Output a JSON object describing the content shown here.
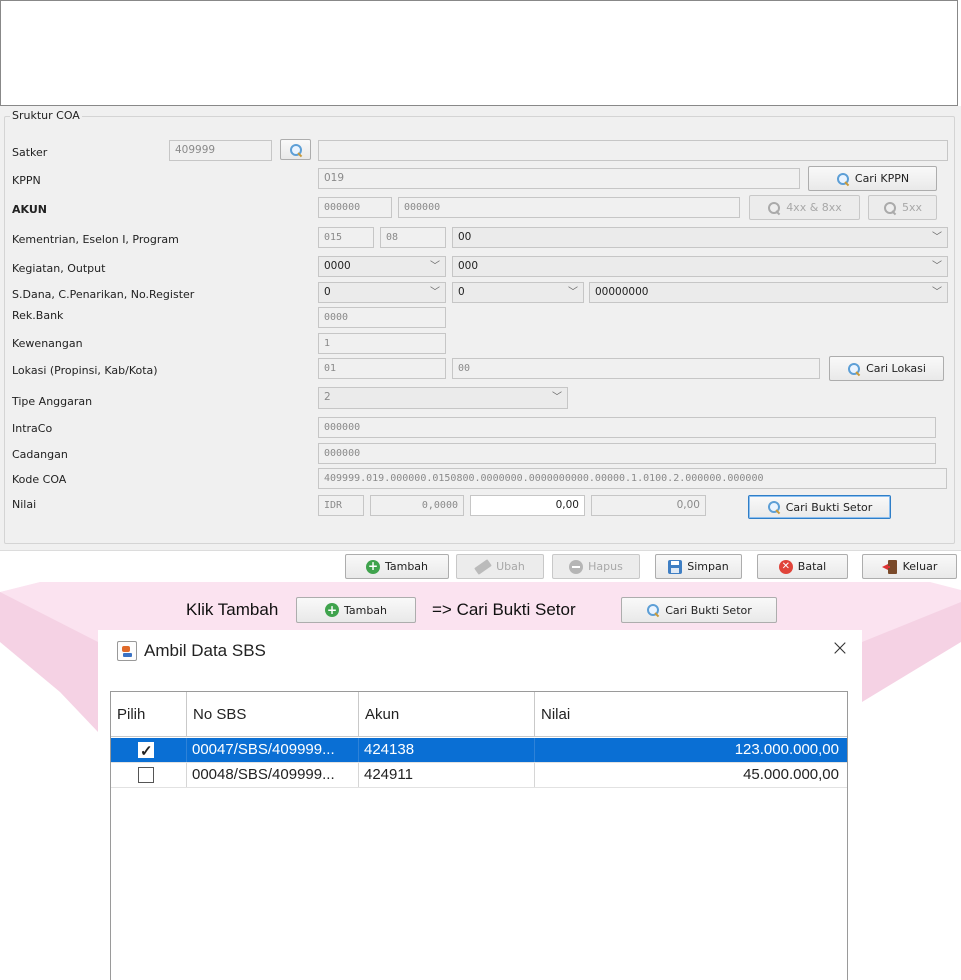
{
  "coa": {
    "group_title": "Sruktur COA",
    "labels": {
      "satker": "Satker",
      "kppn": "KPPN",
      "akun": "AKUN",
      "kementrian": "Kementrian, Eselon I, Program",
      "kegiatan": "Kegiatan, Output",
      "sdana": "S.Dana, C.Penarikan, No.Register",
      "rekbank": "Rek.Bank",
      "kewenangan": "Kewenangan",
      "lokasi": "Lokasi (Propinsi, Kab/Kota)",
      "tipe": "Tipe Anggaran",
      "intraco": "IntraCo",
      "cadangan": "Cadangan",
      "kodecoa": "Kode COA",
      "nilai": "Nilai"
    },
    "values": {
      "satker": "409999",
      "satker_name": "",
      "kppn": "019",
      "akun_code": "000000",
      "akun_name": "000000",
      "kementrian": "015",
      "eselon": "08",
      "program": "00",
      "kegiatan": "0000",
      "output": "000",
      "sdana": "0",
      "cpenarikan": "0",
      "noregister": "00000000",
      "rekbank": "0000",
      "kewenangan": "1",
      "propinsi": "01",
      "kabkota": "00",
      "tipe": "2",
      "intraco": "000000",
      "cadangan": "000000",
      "kodecoa": "409999.019.000000.0150800.0000000.0000000000.00000.1.0100.2.000000.000000",
      "currency": "IDR",
      "kurs": "0,0000",
      "nilai": "0,00",
      "nilai_idr": "0,00"
    },
    "buttons": {
      "cari_kppn": "Cari KPPN",
      "akun_4xx": "4xx & 8xx",
      "akun_5xx": "5xx",
      "cari_lokasi": "Cari Lokasi",
      "cari_bukti": "Cari Bukti Setor"
    }
  },
  "toolbar": {
    "tambah": "Tambah",
    "ubah": "Ubah",
    "hapus": "Hapus",
    "simpan": "Simpan",
    "batal": "Batal",
    "keluar": "Keluar"
  },
  "instruction": {
    "part1": "Klik Tambah",
    "btn1": "Tambah",
    "part2": "=> Cari Bukti Setor",
    "btn2": "Cari Bukti Setor"
  },
  "dialog": {
    "title": "Ambil Data SBS",
    "close": "×",
    "columns": [
      "Pilih",
      "No SBS",
      "Akun",
      "Nilai"
    ],
    "rows": [
      {
        "checked": true,
        "no_sbs": "00047/SBS/409999...",
        "akun": "424138",
        "nilai": "123.000.000,00"
      },
      {
        "checked": false,
        "no_sbs": "00048/SBS/409999...",
        "akun": "424911",
        "nilai": "45.000.000,00"
      }
    ]
  },
  "colors": {
    "selection": "#0a6fd4",
    "pink_band": "#fbe3f0"
  }
}
